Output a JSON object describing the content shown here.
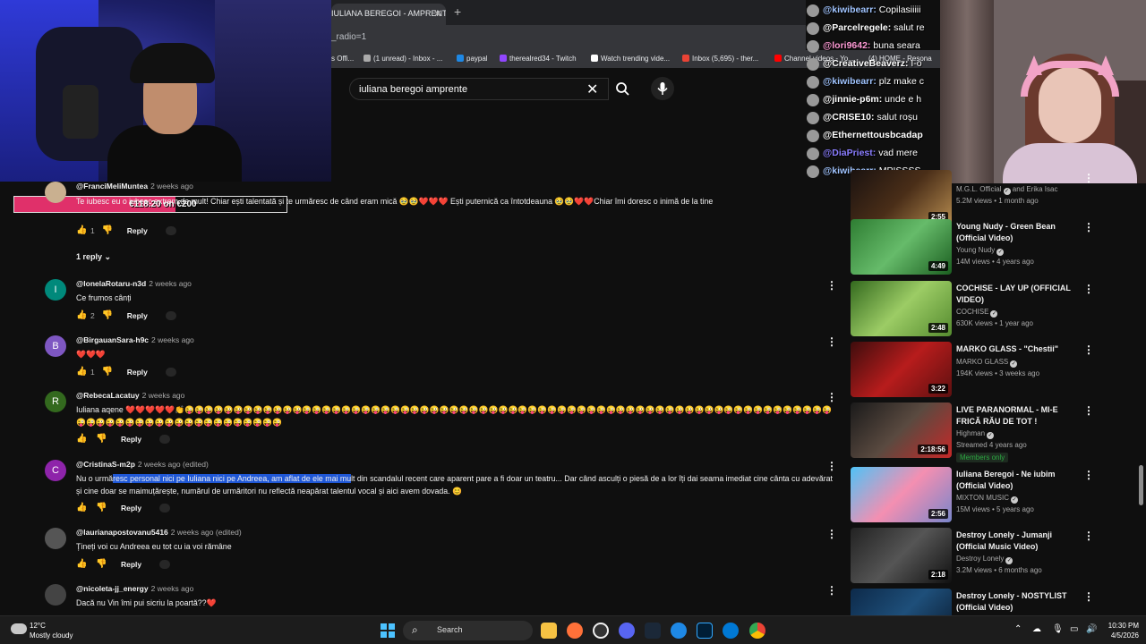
{
  "browser": {
    "tab_title": "IULIANA BEREGOI - AMPRENTE",
    "address_fragment": "_radio=1",
    "bookmarks": [
      "s Offi...",
      "(1 unread) - Inbox - ...",
      "paypal",
      "therealred34 - Twitch",
      "Watch trending vide...",
      "Inbox (5,695) - ther...",
      "Channel videos - Yo...",
      "(4) HOME - Resona"
    ]
  },
  "search": {
    "query": "iuliana beregoi amprente"
  },
  "chat": [
    {
      "user": "@kiwibearr:",
      "text": "Copilasiiiii",
      "color": "#a0c4ff"
    },
    {
      "user": "@Parcelregele:",
      "text": "salut re",
      "color": "#ffffff"
    },
    {
      "user": "@lori9642:",
      "text": "buna seara",
      "color": "#ff9ad5"
    },
    {
      "user": "@CreativeBeaverz:",
      "text": "I-o",
      "color": "#ffffff"
    },
    {
      "user": "@kiwibearr:",
      "text": "plz make c",
      "color": "#a0c4ff"
    },
    {
      "user": "@jinnie-p6m:",
      "text": "unde e h",
      "color": "#ffffff"
    },
    {
      "user": "@CRISE10:",
      "text": "salut roșu",
      "color": "#ffffff"
    },
    {
      "user": "@Ethernettousbcadap",
      "text": "",
      "color": "#ffffff"
    },
    {
      "user": "@DiaPriest:",
      "text": "vad mere",
      "color": "#8a7dff"
    },
    {
      "user": "@kiwibearr:",
      "text": "MPISSSS",
      "color": "#a0c4ff"
    }
  ],
  "donation": {
    "text": "€118.20 on €200",
    "progress": 0.591
  },
  "comments": [
    {
      "user": "@FranciMeliMuntea",
      "time": "2 weeks ago",
      "body": "Te iubesc eu o iubesc extrem de mult! Chiar ești talentată și te urmăresc de când eram mică 🥹🥹❤️❤️❤️ Ești puternică ca întotdeauna 🥹🥹❤️❤️Chiar îmi doresc o inimă de la tine",
      "likes": "1",
      "reply": "Reply",
      "avatar_color": "#c9b090",
      "avatar_letter": ""
    },
    {
      "user": "@IonelaRotaru-n3d",
      "time": "2 weeks ago",
      "body": "Ce frumos cânți",
      "likes": "2",
      "reply": "Reply",
      "avatar_color": "#00897b",
      "avatar_letter": "I"
    },
    {
      "user": "@BirgauanSara-h9c",
      "time": "2 weeks ago",
      "body": "❤️❤️❤️",
      "likes": "1",
      "reply": "Reply",
      "avatar_color": "#7e57c2",
      "avatar_letter": "B"
    },
    {
      "user": "@RebecaLacatuy",
      "time": "2 weeks ago",
      "body": "Iuliana aqene ❤️❤️❤️❤️❤️👏😜😜😜😜😜😜😜😜😜😜😜😜😜😜😜😜😜😜😜😜😜😜😜😜😜😜😜😜😜😜😜😜😜😜😜😜😜😜😜😜😜😜😜😜😜😜😜😜😜😜😜😜😜😜😜😜😜😜😜😜😜😜😜😜😜😜😜😜😜😜😜😜😜😜😜😜😜😜😜😜😜😜😜😜😜😜😜",
      "likes": "",
      "reply": "Reply",
      "avatar_color": "#33691e",
      "avatar_letter": "R"
    },
    {
      "user": "@CristinaS-m2p",
      "time": "2 weeks ago (edited)",
      "body_pre": "Nu o urmă",
      "body_sel": "resc personal nici pe Iuliana nici pe Andreea, am aflat de ele mai mu",
      "body_post": "lt din scandalul recent care aparent pare a fi doar un teatru... Dar când asculți o piesă de a lor îți dai seama imediat cine cânta cu adevărat și cine doar se maimuțărește, numărul de urmăritori nu reflectă neapărat talentul vocal și aici avem dovada. 😊",
      "likes": "",
      "reply": "Reply",
      "avatar_color": "#8e24aa",
      "avatar_letter": "C"
    },
    {
      "user": "@laurianapostovanu5416",
      "time": "2 weeks ago (edited)",
      "body": "Țineți voi cu Andreea eu tot cu ia voi rămâne",
      "likes": "",
      "reply": "Reply",
      "avatar_color": "#555",
      "avatar_letter": ""
    },
    {
      "user": "@nicoleta-jj_energy",
      "time": "2 weeks ago",
      "body": "Dacă nu Vin îmi pui sicriu la poartă??❤️",
      "likes": "",
      "reply": "",
      "avatar_color": "#444",
      "avatar_letter": ""
    }
  ],
  "replies_toggle": "1 reply",
  "videos": [
    {
      "title": "",
      "channel": "M.G.L. Official",
      "channel_extra": "and Erika Isac",
      "meta": "5.2M views • 1 month ago",
      "duration": "2:55",
      "thumb": "linear-gradient(135deg,#1a1210,#4a2e18,#b58b4f)"
    },
    {
      "title": "Young Nudy - Green Bean (Official Video)",
      "channel": "Young Nudy",
      "meta": "14M views • 4 years ago",
      "duration": "4:49",
      "thumb": "linear-gradient(135deg,#2e7d32,#66bb6a,#1b5e20)"
    },
    {
      "title": "COCHISE - LAY UP (OFFICIAL VIDEO)",
      "channel": "COCHISE",
      "meta": "630K views • 1 year ago",
      "duration": "2:48",
      "thumb": "linear-gradient(135deg,#33691e,#9ccc65,#558b2f)"
    },
    {
      "title": "MARKO GLASS - \"Chestii\"",
      "channel": "MARKO GLASS",
      "meta": "194K views • 3 weeks ago",
      "duration": "3:22",
      "thumb": "linear-gradient(135deg,#3e0d0d,#b71c1c,#5d1010)"
    },
    {
      "title": "LIVE PARANORMAL - MI-E FRICĂ RĂU DE TOT !",
      "channel": "Highman",
      "meta": "Streamed 4 years ago",
      "duration": "2:18:56",
      "members": "Members only",
      "thumb": "linear-gradient(135deg,#1a1a1a,#5a4a40,#c62828)"
    },
    {
      "title": "Iuliana Beregoi - Ne iubim (Official Video)",
      "channel": "MIXTON MUSIC",
      "meta": "15M views • 5 years ago",
      "duration": "2:56",
      "thumb": "linear-gradient(135deg,#4fc3f7,#f48fb1,#7986cb)"
    },
    {
      "title": "Destroy Lonely - Jumanji (Official Music Video)",
      "channel": "Destroy Lonely",
      "meta": "3.2M views • 6 months ago",
      "duration": "2:18",
      "thumb": "linear-gradient(135deg,#222,#555,#111)"
    },
    {
      "title": "Destroy Lonely - NOSTYLIST (Official Video)",
      "channel": "",
      "meta": "",
      "duration": "",
      "thumb": "linear-gradient(135deg,#0d2a4a,#1e4f7a,#0a1a2e)"
    }
  ],
  "taskbar": {
    "temp": "12°C",
    "weather": "Mostly cloudy",
    "search_label": "Search",
    "time": "10:30 PM",
    "date": "4/5/2026"
  },
  "colors": {
    "background": "#0f0f0f",
    "donation_fill": "#e0306a",
    "selection": "#1f57d6"
  }
}
